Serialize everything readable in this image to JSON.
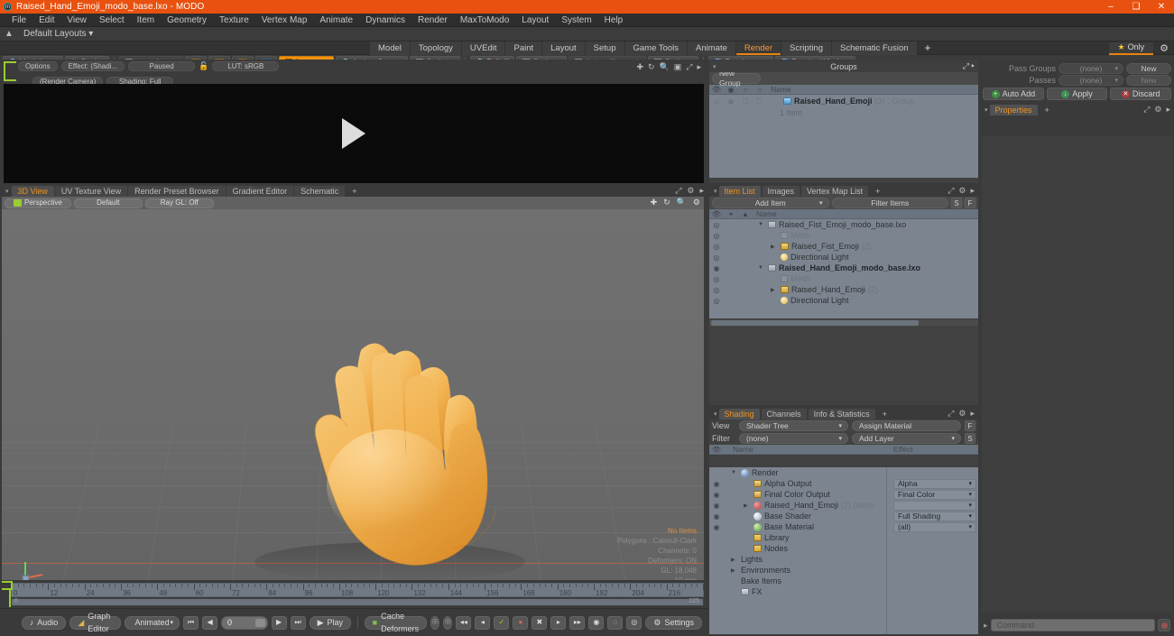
{
  "window": {
    "title": "Raised_Hand_Emoji_modo_base.lxo - MODO",
    "app_icon": "modo-app-icon",
    "minimize": "–",
    "maximize": "❑",
    "close": "✕",
    "accent": "#e8510f"
  },
  "menubar": {
    "items": [
      "File",
      "Edit",
      "View",
      "Select",
      "Item",
      "Geometry",
      "Texture",
      "Vertex Map",
      "Animate",
      "Dynamics",
      "Render",
      "MaxToModo",
      "Layout",
      "System",
      "Help"
    ]
  },
  "layoutrow": {
    "home_icon": "home-icon",
    "layout_label": "Default Layouts",
    "caret": "▾"
  },
  "tabrow": {
    "tabs": [
      "Model",
      "Topology",
      "UVEdit",
      "Paint",
      "Layout",
      "Setup",
      "Game Tools",
      "Animate",
      "Render",
      "Scripting",
      "Schematic Fusion"
    ],
    "active": "Render",
    "add": "+",
    "only_label": "Only",
    "star_icon": "star-icon",
    "gear_icon": "gear-icon"
  },
  "modebar": {
    "model_label": "Model",
    "model_key": "F2",
    "sculpt_label": "Sculpt",
    "auto_select_label": "Auto Select",
    "items_label": "Items",
    "items_key": "5",
    "action_center_label": "Action Center",
    "options_label": "Options",
    "falloff_label": "Falloff",
    "options2_label": "Options",
    "select_through_label": "Select Through",
    "render_label": "Render",
    "render_key": "F9",
    "render_window_label": "Render Window"
  },
  "render_preview": {
    "options_label": "Options",
    "effect_label": "Effect: (Shadi...",
    "paused_label": "Paused",
    "lock_icon": "unlock-icon",
    "lut_label": "LUT: sRGB",
    "camera_label": "(Render Camera)",
    "shading_label": "Shading: Full",
    "nav_icons": [
      "move-icon",
      "rotate-icon",
      "zoom-icon",
      "fit-icon",
      "maximize-icon",
      "menu-arrow-icon"
    ],
    "play_icon": "play-icon"
  },
  "viewport_tabs": {
    "tabs": [
      "3D View",
      "UV Texture View",
      "Render Preset Browser",
      "Gradient Editor",
      "Schematic"
    ],
    "active": "3D View",
    "add": "+",
    "right_icons": [
      "expand-icon",
      "gear-icon",
      "menu-arrow-icon"
    ]
  },
  "viewport": {
    "perspective_label": "Perspective",
    "default_label": "Default",
    "rayql_label": "Ray GL: Off",
    "right_icons": [
      "move-icon",
      "rotate-icon",
      "zoom-icon",
      "gear-icon"
    ],
    "stats": {
      "no_items": "No Items",
      "polygons": "Polygons : Catmull-Clark",
      "channels": "Channels: 0",
      "deformers": "Deformers: ON",
      "gl": "GL: 18,048",
      "scale": "10 mm"
    }
  },
  "timeline": {
    "ticks": [
      0,
      12,
      24,
      36,
      48,
      60,
      72,
      84,
      96,
      108,
      120,
      132,
      144,
      156,
      168,
      180,
      192,
      204,
      216
    ],
    "scroll_start": "0",
    "scroll_end": "225",
    "playhead_frame": 0
  },
  "bottombar": {
    "audio_label": "Audio",
    "graph_editor_label": "Graph Editor",
    "animated_label": "Animated",
    "frame_value": "0",
    "play_label": "Play",
    "cache_deformers_label": "Cache Deformers",
    "settings_label": "Settings",
    "transport": {
      "first": "⏮",
      "prev": "◀",
      "next": "▶",
      "last": "⏭"
    },
    "icons": [
      "audio-icon",
      "graph-editor-icon",
      "cache-deformers-icon",
      "settings-icon"
    ]
  },
  "groups_panel": {
    "title": "Groups",
    "new_group_label": "New Group",
    "columns": [
      "eye-column",
      "lock-column",
      "render-column",
      "select-column",
      "Name"
    ],
    "rows": [
      {
        "name": "Raised_Hand_Emoji",
        "count": "(3)",
        "type": ": Group",
        "sub": "1 Item"
      }
    ]
  },
  "item_list_panel": {
    "tabs": [
      "Item List",
      "Images",
      "Vertex Map List"
    ],
    "active_tab": "Item List",
    "add": "+",
    "add_item_label": "Add Item",
    "filter_items_label": "Filter Items",
    "s_label": "S",
    "f_label": "F",
    "name_col": "Name",
    "rows": [
      {
        "indent": 0,
        "tri": "▼",
        "icon": "file-icon",
        "name": "Raised_Fist_Emoji_modo_base.lxo",
        "bold": false,
        "dim": false,
        "count": ""
      },
      {
        "indent": 1,
        "tri": "",
        "icon": "mesh-icon",
        "name": "Mesh",
        "bold": false,
        "dim": true,
        "count": ""
      },
      {
        "indent": 1,
        "tri": "▶",
        "icon": "group-icon",
        "name": "Raised_Fist_Emoji",
        "bold": false,
        "dim": false,
        "count": "(2)"
      },
      {
        "indent": 1,
        "tri": "",
        "icon": "light-icon",
        "name": "Directional Light",
        "bold": false,
        "dim": false,
        "count": ""
      },
      {
        "indent": 0,
        "tri": "▼",
        "icon": "file-icon",
        "name": "Raised_Hand_Emoji_modo_base.lxo",
        "bold": true,
        "dim": false,
        "count": ""
      },
      {
        "indent": 1,
        "tri": "",
        "icon": "mesh-icon",
        "name": "Mesh",
        "bold": false,
        "dim": true,
        "count": ""
      },
      {
        "indent": 1,
        "tri": "▶",
        "icon": "group-icon",
        "name": "Raised_Hand_Emoji",
        "bold": false,
        "dim": false,
        "count": "(2)"
      },
      {
        "indent": 1,
        "tri": "",
        "icon": "light-icon",
        "name": "Directional Light",
        "bold": false,
        "dim": false,
        "count": ""
      }
    ]
  },
  "shading_panel": {
    "tabs": [
      "Shading",
      "Channels",
      "Info & Statistics"
    ],
    "active_tab": "Shading",
    "add": "+",
    "view_label": "View",
    "view_value": "Shader Tree",
    "assign_material_label": "Assign Material",
    "f_label": "F",
    "filter_label": "Filter",
    "filter_value": "(none)",
    "add_layer_label": "Add Layer",
    "s_label": "S",
    "name_col": "Name",
    "effect_col": "Effect",
    "rows": [
      {
        "indent": 0,
        "tri": "▼",
        "icon": "render-icon",
        "name": "Render",
        "effect": "",
        "eye": false,
        "dim": false,
        "count": ""
      },
      {
        "indent": 1,
        "tri": "",
        "icon": "alpha-icon",
        "name": "Alpha Output",
        "effect": "Alpha",
        "eye": true,
        "dim": false,
        "count": ""
      },
      {
        "indent": 1,
        "tri": "",
        "icon": "alpha-icon",
        "name": "Final Color Output",
        "effect": "Final Color",
        "eye": true,
        "dim": false,
        "count": ""
      },
      {
        "indent": 1,
        "tri": "▶",
        "icon": "material-icon",
        "name": "Raised_Hand_Emoji",
        "effect": "",
        "eye": true,
        "dim": false,
        "count": "(2) (Item)"
      },
      {
        "indent": 1,
        "tri": "",
        "icon": "shader-icon",
        "name": "Base Shader",
        "effect": "Full Shading",
        "eye": true,
        "dim": false,
        "count": ""
      },
      {
        "indent": 1,
        "tri": "",
        "icon": "basematerial-icon",
        "name": "Base Material",
        "effect": "(all)",
        "eye": true,
        "dim": false,
        "count": ""
      },
      {
        "indent": 1,
        "tri": "",
        "icon": "folder-icon",
        "name": "Library",
        "effect": "",
        "eye": false,
        "dim": false,
        "count": ""
      },
      {
        "indent": 1,
        "tri": "",
        "icon": "folder-icon",
        "name": "Nodes",
        "effect": "",
        "eye": false,
        "dim": false,
        "count": ""
      },
      {
        "indent": 0,
        "tri": "▶",
        "icon": "",
        "name": "Lights",
        "effect": "",
        "eye": false,
        "dim": false,
        "count": ""
      },
      {
        "indent": 0,
        "tri": "▶",
        "icon": "",
        "name": "Environments",
        "effect": "",
        "eye": false,
        "dim": false,
        "count": ""
      },
      {
        "indent": 0,
        "tri": "",
        "icon": "",
        "name": "Bake Items",
        "effect": "",
        "eye": false,
        "dim": false,
        "count": ""
      },
      {
        "indent": 0,
        "tri": "",
        "icon": "fx-icon",
        "name": "FX",
        "effect": "",
        "eye": false,
        "dim": false,
        "count": ""
      }
    ]
  },
  "passes_panel": {
    "pass_groups_label": "Pass Groups",
    "pass_groups_value": "(none)",
    "pass_groups_new": "New",
    "passes_label": "Passes",
    "passes_value": "(none)",
    "passes_new": "New",
    "auto_add_label": "Auto Add",
    "apply_label": "Apply",
    "discard_label": "Discard"
  },
  "properties_panel": {
    "tabs": [
      "Properties"
    ],
    "active_tab": "Properties",
    "add": "+",
    "right_icons": [
      "expand-icon",
      "gear-icon",
      "menu-arrow-icon"
    ]
  },
  "command_bar": {
    "arrow": "▸",
    "placeholder": "Command",
    "record_icon": "record-icon"
  }
}
